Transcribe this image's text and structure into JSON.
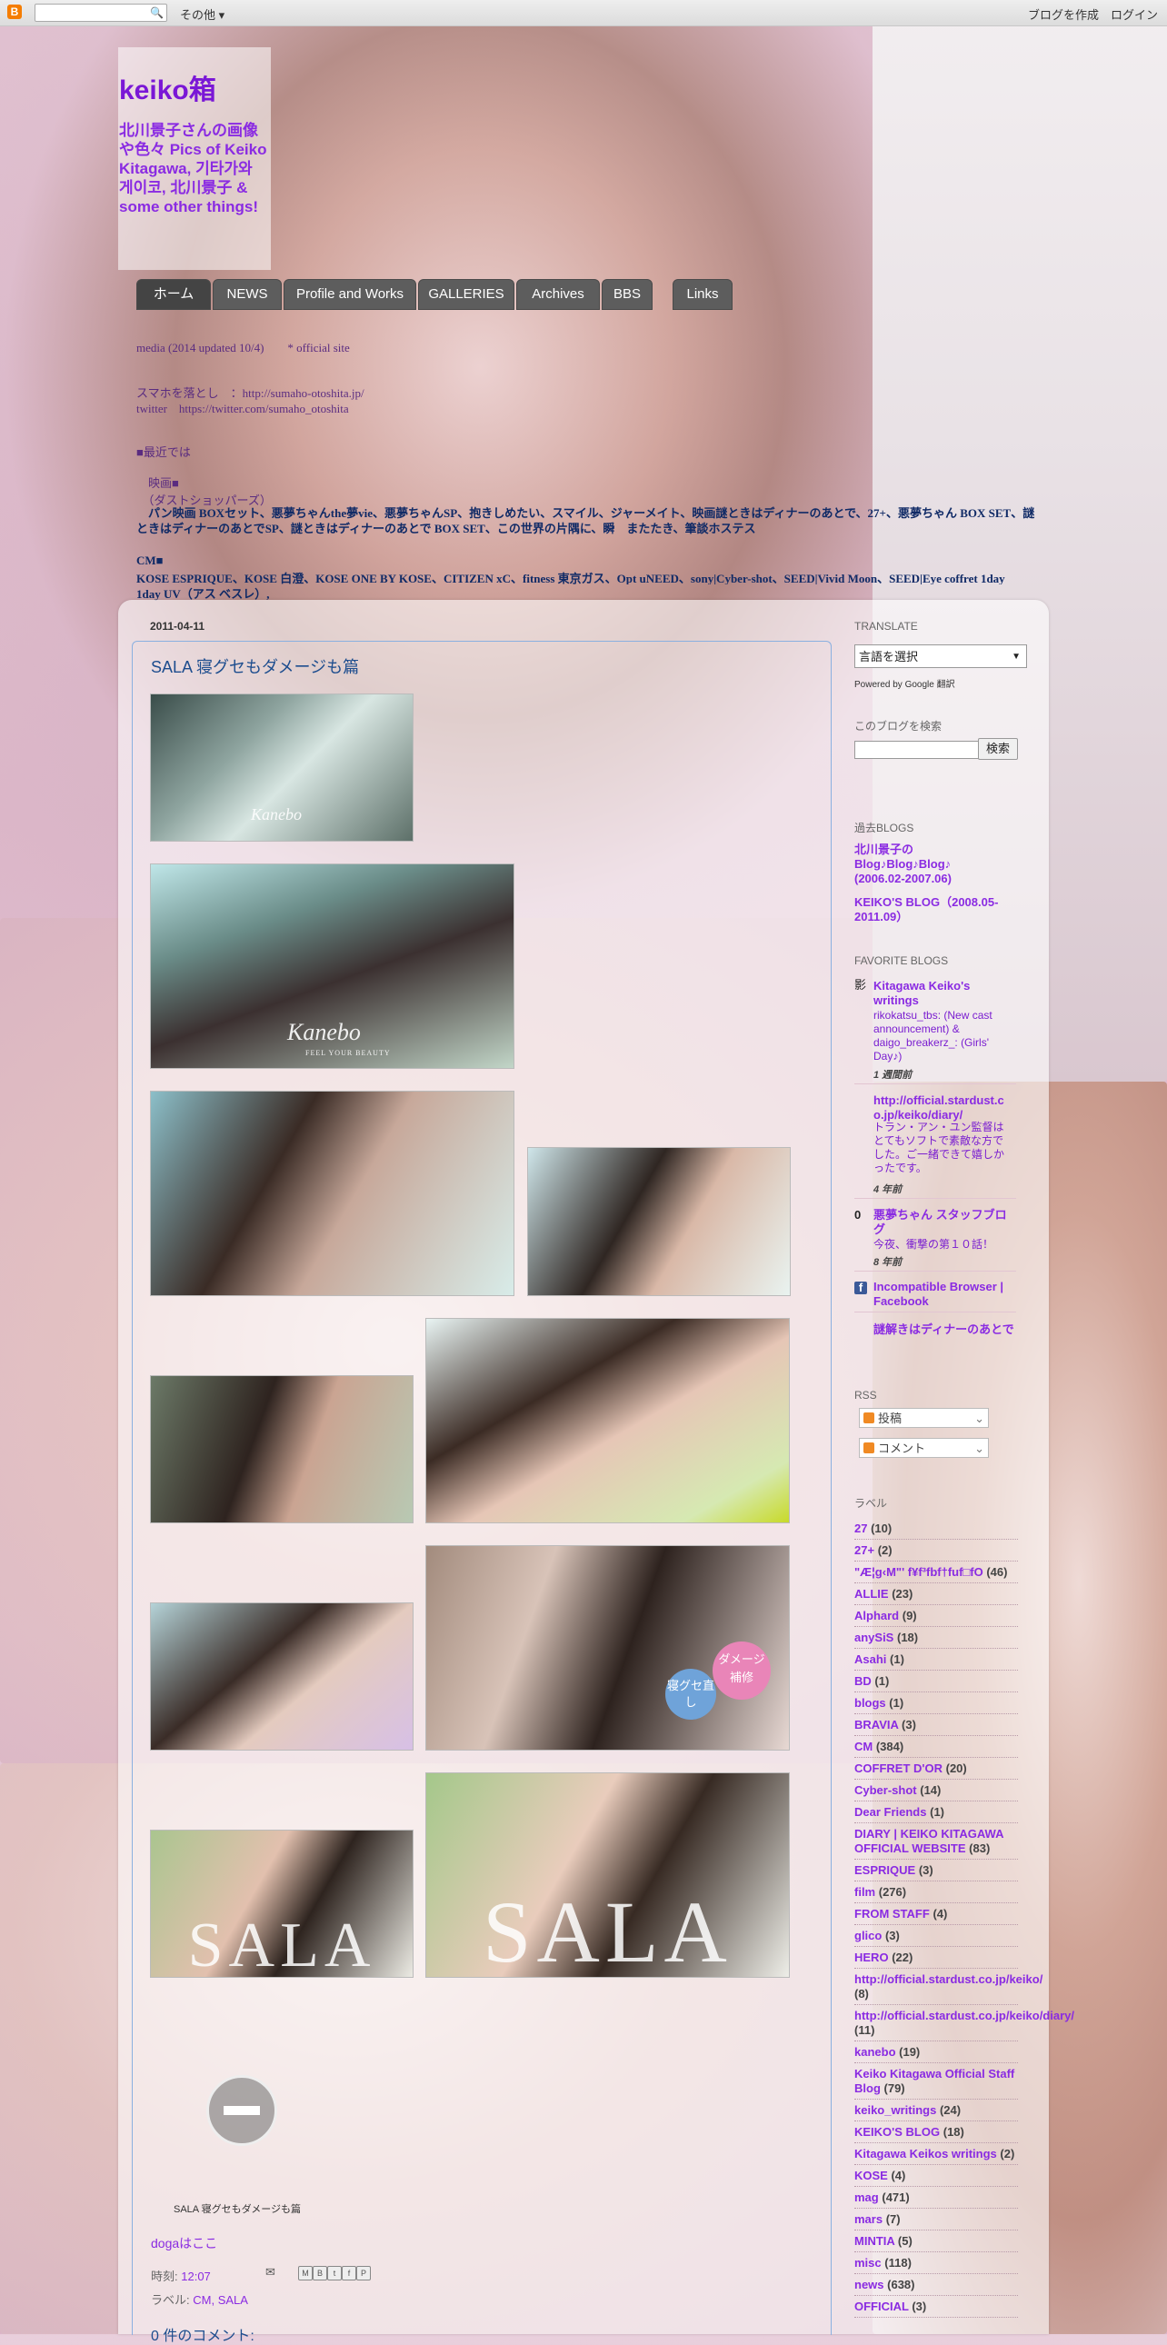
{
  "navbar": {
    "icon": "B",
    "more": "その他 ▾",
    "create_blog": "ブログを作成",
    "login": "ログイン"
  },
  "header": {
    "title": "keiko箱",
    "description": "北川景子さんの画像や色々 Pics of Keiko Kitagawa, 기타가와 게이코, 北川景子 & some other things!"
  },
  "tabs": [
    "ホーム",
    "NEWS",
    "Profile and Works",
    "GALLERIES",
    "Archives",
    "BBS",
    "Links"
  ],
  "info": {
    "line1": "media (2014 updated 10/4)　　* official site",
    "line2": "スマホを落とし　：http://sumaho-otoshita.jp/",
    "line3": "twitter　https://twitter.com/sumaho_otoshita",
    "line4": "■最近では",
    "line5": "　映画■",
    "line6": "　（ダストショッパーズ）",
    "line7": "　パン映画 BOXセット、悪夢ちゃんthe夢vie、悪夢ちゃんSP、抱きしめたい、スマイル、ジャーメイト、映画謎ときはディナーのあとで、27+、悪夢ちゃん BOX SET、謎ときはディナーのあとでSP、謎ときはディナーのあとで BOX SET、この世界の片隅に、瞬　またたき、筆談ホステス",
    "cm_title": "CM■",
    "cm_line1": "KOSE ESPRIQUE、KOSE 白澄、KOSE ONE BY KOSE、CITIZEN xC、fitness 東京ガス、Opt uNEED、sony|Cyber-shot、SEED|Vivid Moon、SEED|Eye coffret 1day UV、アスベスレ",
    "cm_line2": "1day UV（アス ベスレ）,"
  },
  "post": {
    "date": "2011-04-11",
    "title": "SALA 寝グセもダメージも篇",
    "images": [
      {
        "watermark": "Kanebo"
      },
      {
        "watermark": "Kanebo",
        "sub": "FEEL YOUR BEAUTY"
      },
      {
        "watermark": ""
      },
      {
        "watermark": ""
      },
      {
        "watermark": ""
      },
      {
        "watermark": ""
      },
      {
        "watermark": ""
      },
      {
        "bubble1": "ダメージ補修",
        "bubble2": "寝グセ直し"
      },
      {
        "sala": "SALA"
      },
      {
        "sala": "SALA"
      }
    ],
    "video_caption": "SALA 寝グセもダメージも篇",
    "doga_link": "dogaはここ",
    "time_label": "時刻:",
    "time_value": "12:07",
    "labels_label": "ラベル:",
    "labels_value": "CM, SALA",
    "comments": "0 件のコメント:"
  },
  "sidebar": {
    "translate_heading": "TRANSLATE",
    "translate_select": "言語を選択",
    "powered": "Powered by Google 翻訳",
    "search_heading": "このブログを検索",
    "search_button": "検索",
    "past_heading": "過去BLOGS",
    "past_links": [
      "北川景子の Blog♪Blog♪Blog♪ (2006.02-2007.06)",
      "KEIKO'S BLOG（2008.05-2011.09）"
    ],
    "fav_heading": "FAVORITE BLOGS",
    "favorites": [
      {
        "icon": "影",
        "title": "Kitagawa Keiko's writings",
        "text": "rikokatsu_tbs: (New cast announcement) & daigo_breakerz_: (Girls' Day♪)",
        "age": "1 週間前"
      },
      {
        "icon": "",
        "title": "http://official.stardust.co.jp/keiko/diary/",
        "text": "トラン・アン・ユン監督はとてもソフトで素敵な方でした。ご一緒できて嬉しかったです。",
        "age": "4 年前"
      },
      {
        "icon": "0",
        "title": "悪夢ちゃん スタッフブログ",
        "text": "今夜、衝撃の第１０話！",
        "age": "8 年前"
      },
      {
        "icon": "f",
        "title": "Incompatible Browser | Facebook",
        "text": "",
        "age": ""
      },
      {
        "icon": "",
        "title": "謎解きはディナーのあとで",
        "text": "",
        "age": ""
      }
    ],
    "rss_heading": "RSS",
    "rss_posts": "投稿",
    "rss_comments": "コメント",
    "labels_heading": "ラベル",
    "labels": [
      {
        "name": "27",
        "count": "(10)"
      },
      {
        "name": "27+",
        "count": "(2)"
      },
      {
        "name": "\"Æ¦g‹M\"' f¥f³fbf†fuf□fO",
        "count": "(46)"
      },
      {
        "name": "ALLIE",
        "count": "(23)"
      },
      {
        "name": "Alphard",
        "count": "(9)"
      },
      {
        "name": "anySiS",
        "count": "(18)"
      },
      {
        "name": "Asahi",
        "count": "(1)"
      },
      {
        "name": "BD",
        "count": "(1)"
      },
      {
        "name": "blogs",
        "count": "(1)"
      },
      {
        "name": "BRAVIA",
        "count": "(3)"
      },
      {
        "name": "CM",
        "count": "(384)"
      },
      {
        "name": "COFFRET D'OR",
        "count": "(20)"
      },
      {
        "name": "Cyber-shot",
        "count": "(14)"
      },
      {
        "name": "Dear Friends",
        "count": "(1)"
      },
      {
        "name": "DIARY | KEIKO KITAGAWA OFFICIAL WEBSITE",
        "count": "(83)"
      },
      {
        "name": "ESPRIQUE",
        "count": "(3)"
      },
      {
        "name": "film",
        "count": "(276)"
      },
      {
        "name": "FROM STAFF",
        "count": "(4)"
      },
      {
        "name": "glico",
        "count": "(3)"
      },
      {
        "name": "HERO",
        "count": "(22)"
      },
      {
        "name": "http://official.stardust.co.jp/keiko/",
        "count": "(8)"
      },
      {
        "name": "http://official.stardust.co.jp/keiko/diary/",
        "count": "(11)"
      },
      {
        "name": "kanebo",
        "count": "(19)"
      },
      {
        "name": "Keiko Kitagawa Official Staff Blog",
        "count": "(79)"
      },
      {
        "name": "keiko_writings",
        "count": "(24)"
      },
      {
        "name": "KEIKO'S BLOG",
        "count": "(18)"
      },
      {
        "name": "Kitagawa Keikos writings",
        "count": "(2)"
      },
      {
        "name": "KOSE",
        "count": "(4)"
      },
      {
        "name": "mag",
        "count": "(471)"
      },
      {
        "name": "mars",
        "count": "(7)"
      },
      {
        "name": "MINTIA",
        "count": "(5)"
      },
      {
        "name": "misc",
        "count": "(118)"
      },
      {
        "name": "news",
        "count": "(638)"
      },
      {
        "name": "OFFICIAL",
        "count": "(3)"
      }
    ]
  }
}
